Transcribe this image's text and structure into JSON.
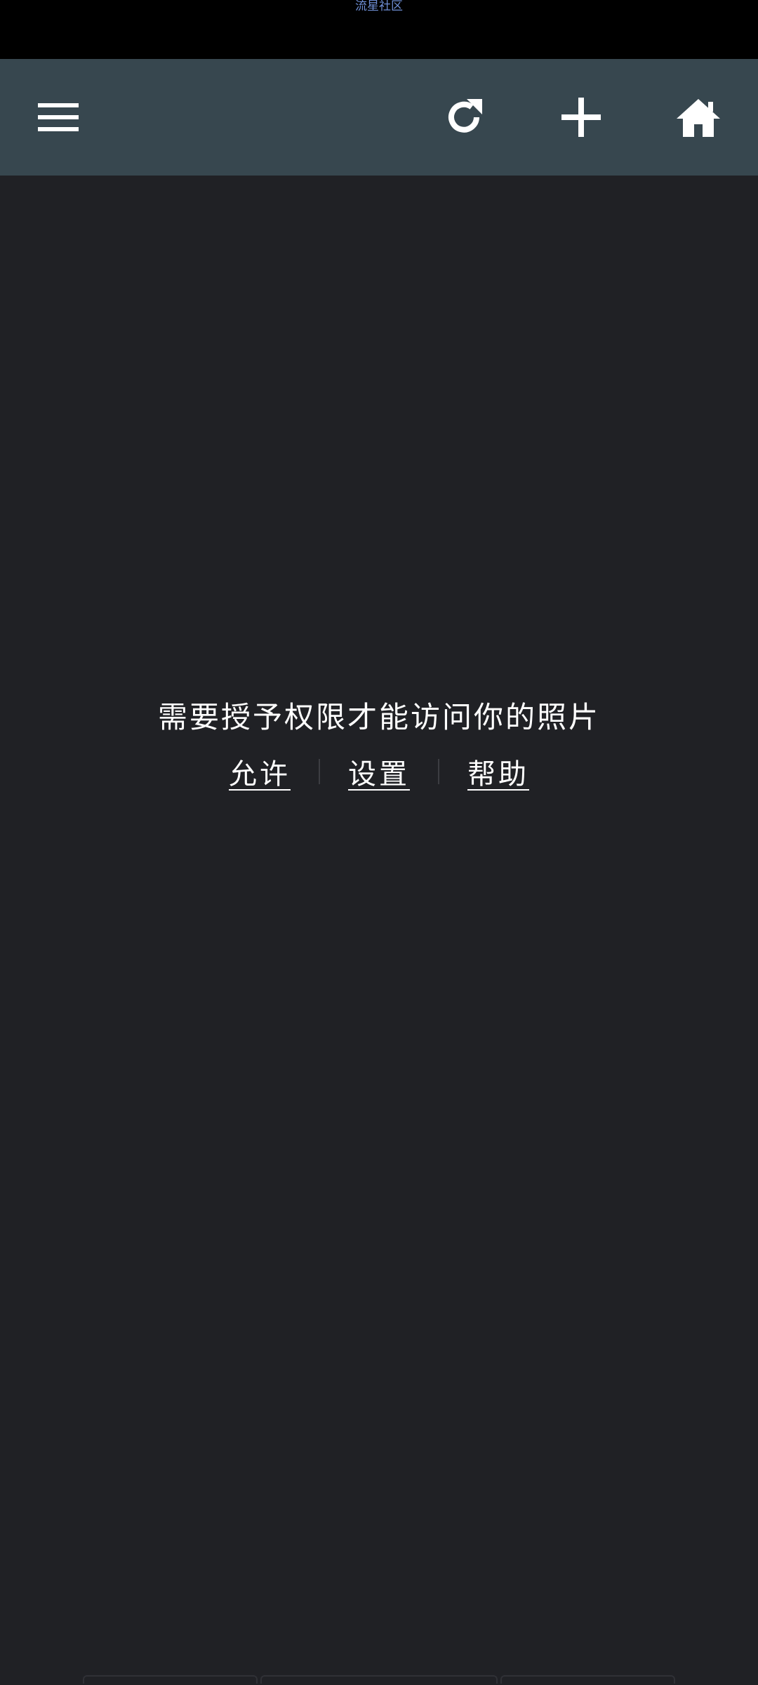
{
  "status_bar": {
    "label": "流星社区"
  },
  "toolbar": {
    "icons": [
      "menu-icon",
      "refresh-icon",
      "plus-icon",
      "home-icon"
    ]
  },
  "permission": {
    "message": "需要授予权限才能访问你的照片",
    "actions": {
      "allow": "允许",
      "settings": "设置",
      "help": "帮助"
    }
  },
  "colors": {
    "status_bar_bg": "#000000",
    "toolbar_bg": "#37474f",
    "content_bg": "#202125",
    "text": "#ffffff",
    "status_label": "#6f8fd6"
  }
}
